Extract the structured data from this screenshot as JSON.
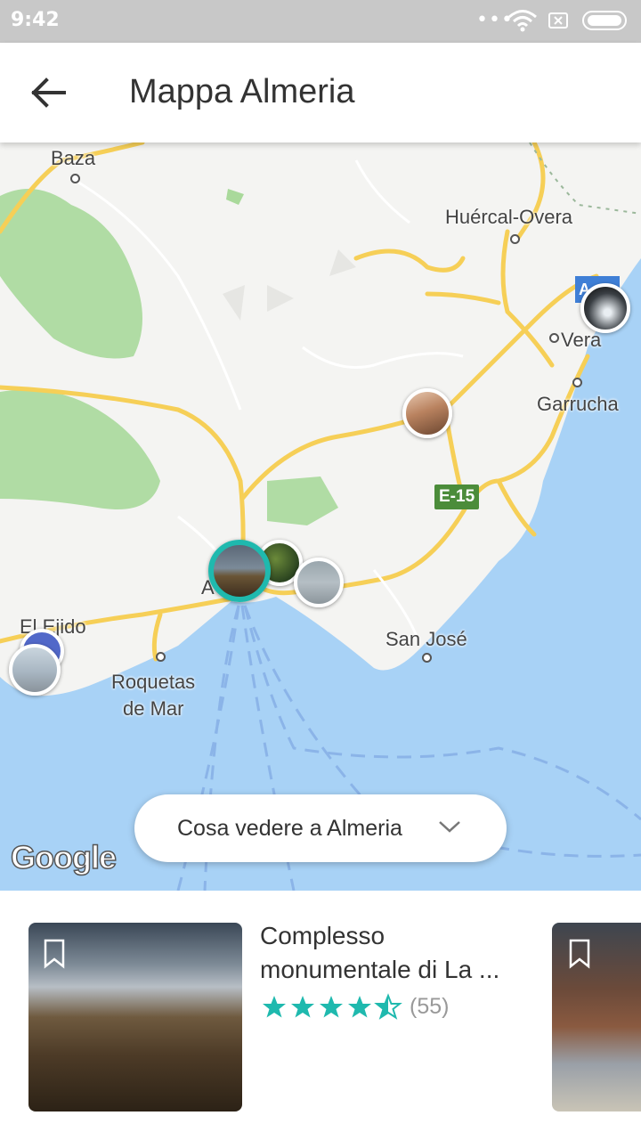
{
  "status_bar": {
    "time": "9:42",
    "dots": "•••"
  },
  "header": {
    "title": "Mappa Almeria"
  },
  "map": {
    "places": {
      "baza": "Baza",
      "huercal": "Huércal-Overa",
      "vera": "Vera",
      "garrucha": "Garrucha",
      "el_ejido": "El Ejido",
      "roquetas_1": "Roquetas",
      "roquetas_2": "de Mar",
      "san_jose": "San José",
      "almeria_initial": "A"
    },
    "road_shield": "E-15",
    "highway_shield": "A",
    "attribution": "Google",
    "dropdown_label": "Cosa vedere a Almeria"
  },
  "cards": [
    {
      "title": "Complesso monumentale di La ...",
      "rating": 4.5,
      "review_count": "(55)"
    }
  ],
  "colors": {
    "accent": "#1fb9ae",
    "map_water": "#a8d2f6",
    "map_land": "#f4f4f2",
    "park": "#a9d99b"
  }
}
